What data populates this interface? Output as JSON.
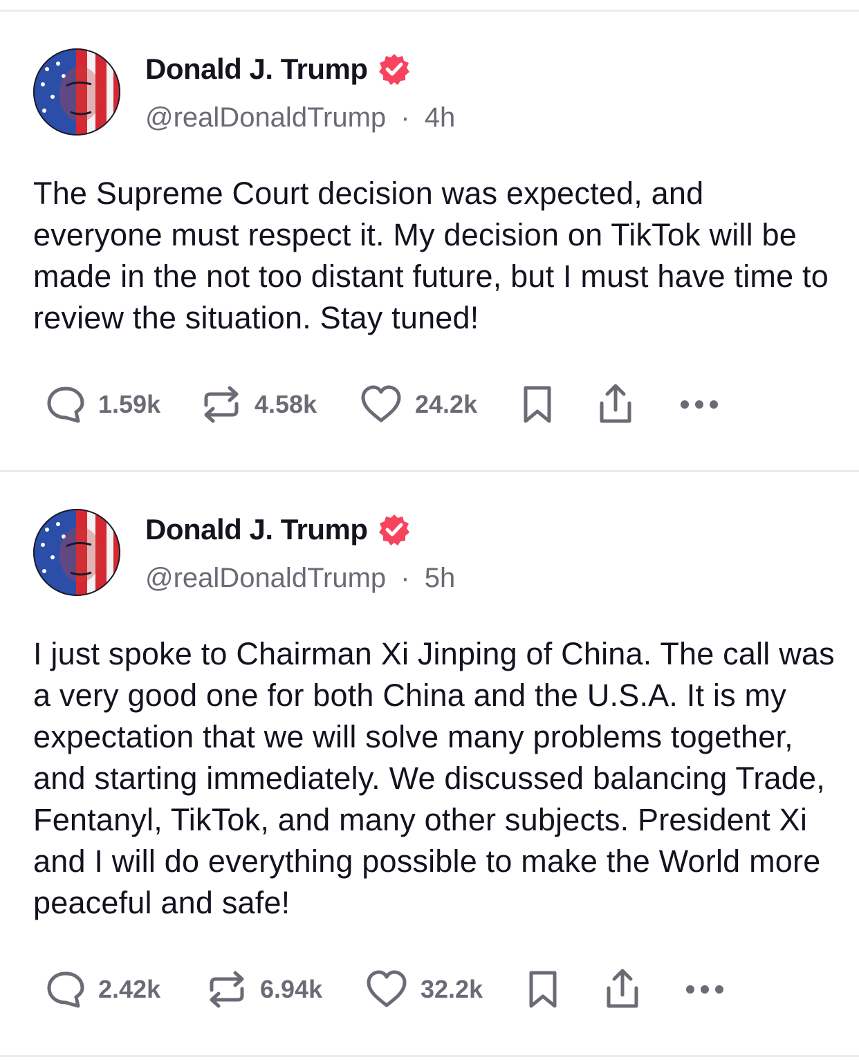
{
  "posts": [
    {
      "display_name": "Donald J. Trump",
      "handle": "@realDonaldTrump",
      "separator": "·",
      "time": "4h",
      "verified": true,
      "body": "The Supreme Court decision was expected, and everyone must respect it. My decision on TikTok will be made in the not too distant future, but I must have time to review the situation. Stay tuned!",
      "stats": {
        "replies": "1.59k",
        "reposts": "4.58k",
        "likes": "24.2k"
      }
    },
    {
      "display_name": "Donald J. Trump",
      "handle": "@realDonaldTrump",
      "separator": "·",
      "time": "5h",
      "verified": true,
      "body": "I just spoke to Chairman Xi Jinping of China. The call was a very good one for both China and the U.S.A. It is my expectation that we will solve many problems together, and starting immediately. We discussed balancing Trade, Fentanyl, TikTok, and many other subjects. President Xi and I will do everything possible to make the World more peaceful and safe!",
      "stats": {
        "replies": "2.42k",
        "reposts": "6.94k",
        "likes": "32.2k"
      }
    }
  ],
  "icons": {
    "reply": "reply-icon",
    "repost": "repost-icon",
    "like": "heart-icon",
    "bookmark": "bookmark-icon",
    "share": "share-icon",
    "more": "more-icon",
    "verified": "verified-badge-icon"
  },
  "colors": {
    "verified_badge": "#f6435e",
    "text_primary": "#15111f",
    "text_secondary": "#6b6a75",
    "icon": "#6b6a75",
    "divider": "#ececf0"
  }
}
